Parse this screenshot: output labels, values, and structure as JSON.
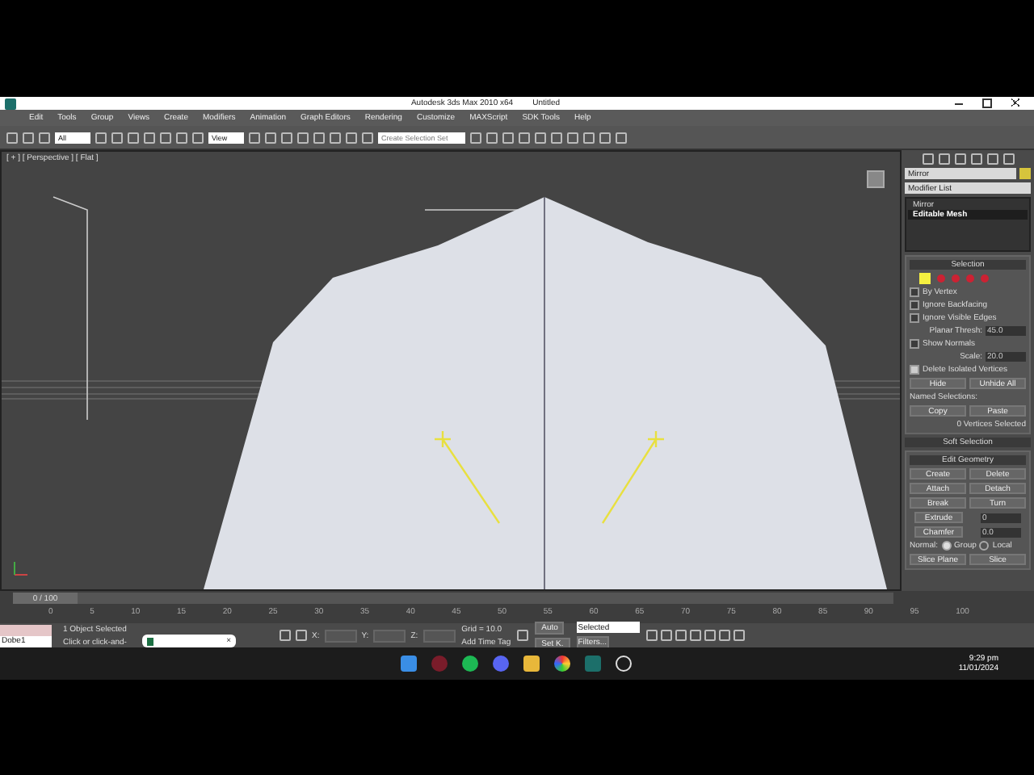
{
  "title_bar": {
    "app_title": "Autodesk 3ds Max  2010 x64",
    "document": "Untitled"
  },
  "menu": [
    "Edit",
    "Tools",
    "Group",
    "Views",
    "Create",
    "Modifiers",
    "Animation",
    "Graph Editors",
    "Rendering",
    "Customize",
    "MAXScript",
    "SDK Tools",
    "Help"
  ],
  "toolbar": {
    "selection_filter": "All",
    "reference_coord": "View",
    "named_selection_placeholder": "Create Selection Set"
  },
  "viewport": {
    "label": "[ + ] [ Perspective ] [ Flat ]"
  },
  "command_panel": {
    "object_name": "Mirror",
    "modifier_list": "Modifier List",
    "stack": [
      {
        "label": "Mirror",
        "selected": false
      },
      {
        "label": "Editable Mesh",
        "selected": true
      }
    ],
    "selection": {
      "title": "Selection",
      "subobjects": [
        {
          "selected": true
        },
        {
          "selected": false
        },
        {
          "selected": false
        },
        {
          "selected": false
        },
        {
          "selected": false
        }
      ],
      "options": [
        {
          "kind": "check",
          "label": "By Vertex",
          "checked": false
        },
        {
          "kind": "check",
          "label": "Ignore Backfacing",
          "checked": false
        },
        {
          "kind": "check",
          "label": "Ignore Visible Edges",
          "checked": false
        },
        {
          "kind": "spinner",
          "label": "Planar Thresh:",
          "value": "45.0"
        },
        {
          "kind": "check",
          "label": "Show Normals",
          "checked": false
        },
        {
          "kind": "spinner",
          "label": "Scale:",
          "value": "20.0"
        },
        {
          "kind": "check",
          "label": "Delete Isolated Vertices",
          "checked": true
        }
      ],
      "buttons": [
        "Hide",
        "Unhide All"
      ],
      "named_selections": "Named Selections:",
      "named_buttons": [
        "Copy",
        "Paste"
      ],
      "status": "0 Vertices Selected"
    },
    "soft_selection": "Soft Selection",
    "edit_geometry": {
      "title": "Edit Geometry",
      "buttons": [
        "Create",
        "Delete",
        "Attach",
        "Detach",
        "Break",
        "Turn"
      ],
      "spinners": [
        {
          "label": "Extrude",
          "value": "0"
        },
        {
          "label": "Chamfer",
          "value": "0.0"
        }
      ],
      "normal_label": "Normal:",
      "normal_options": [
        {
          "label": "Group",
          "selected": true
        },
        {
          "label": "Local",
          "selected": false
        }
      ],
      "bottom_buttons": [
        "Slice Plane",
        "Slice"
      ]
    }
  },
  "timeline": {
    "frame": "0 / 100",
    "level": 0,
    "ticks": [
      "0",
      "5",
      "10",
      "15",
      "20",
      "25",
      "30",
      "35",
      "40",
      "45",
      "50",
      "55",
      "60",
      "65",
      "70",
      "75",
      "80",
      "85",
      "90",
      "95",
      "100"
    ]
  },
  "status_bar": {
    "listener_value": "Dobe1",
    "selected": "1 Object Selected",
    "prompt": "Click or click-and-",
    "x_label": "X:",
    "y_label": "Y:",
    "z_label": "Z:",
    "grid": "Grid = 10.0",
    "add_time_tag": "Add Time Tag",
    "auto_key": "Auto",
    "key_filter": "Selected",
    "set_key": "Set K.",
    "filters": "Filters..."
  },
  "popup": {
    "close": "×"
  },
  "taskbar": {
    "time": "9:29 pm",
    "date": "11/01/2024"
  }
}
